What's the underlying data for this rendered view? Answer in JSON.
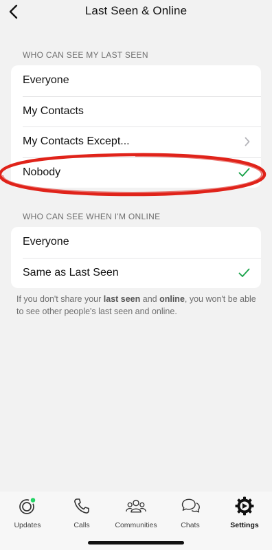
{
  "nav": {
    "title": "Last Seen & Online",
    "back_icon": "chevron-left-icon"
  },
  "last_seen": {
    "header": "WHO CAN SEE MY LAST SEEN",
    "options": [
      {
        "label": "Everyone"
      },
      {
        "label": "My Contacts"
      },
      {
        "label": "My Contacts Except..."
      },
      {
        "label": "Nobody",
        "selected": true
      }
    ]
  },
  "online": {
    "header": "WHO CAN SEE WHEN I'M ONLINE",
    "options": [
      {
        "label": "Everyone"
      },
      {
        "label": "Same as Last Seen",
        "selected": true
      }
    ],
    "footnote": {
      "part1": "If you don't share your ",
      "bold1": "last seen",
      "part2": " and ",
      "bold2": "online",
      "part3": ", you won't be able to see other people's last seen and online."
    }
  },
  "annotation": {
    "highlight": "Nobody",
    "color": "#e0231a"
  },
  "tabbar": {
    "tabs": [
      {
        "label": "Updates",
        "icon": "updates-icon"
      },
      {
        "label": "Calls",
        "icon": "phone-icon"
      },
      {
        "label": "Communities",
        "icon": "communities-icon"
      },
      {
        "label": "Chats",
        "icon": "chats-icon"
      },
      {
        "label": "Settings",
        "icon": "settings-gear-icon",
        "active": true
      }
    ]
  },
  "colors": {
    "accent": "#1aa34a",
    "update_dot": "#25d366",
    "background": "#f2f2f2"
  }
}
